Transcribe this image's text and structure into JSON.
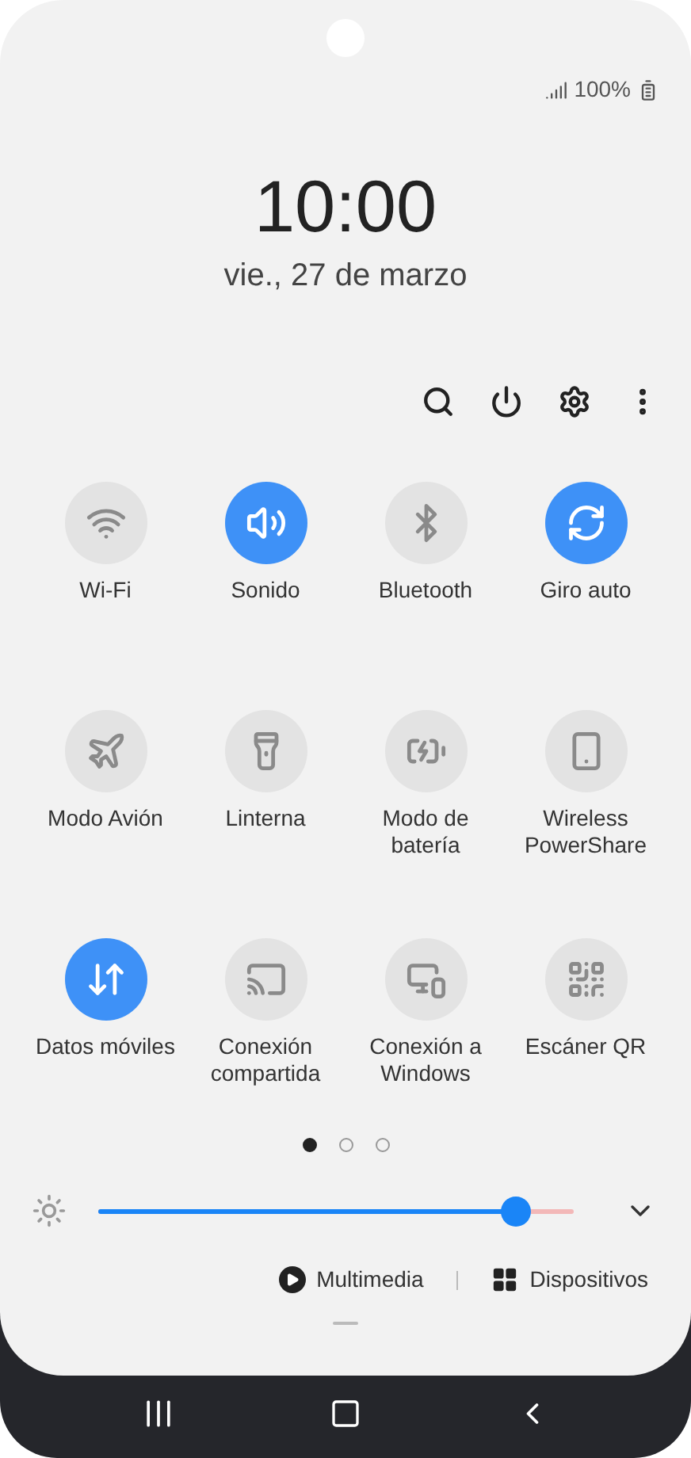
{
  "status_bar": {
    "battery": "100%"
  },
  "clock": {
    "time": "10:00",
    "date": "vie., 27 de marzo"
  },
  "tiles": [
    {
      "label": "Wi-Fi",
      "on": false
    },
    {
      "label": "Sonido",
      "on": true
    },
    {
      "label": "Bluetooth",
      "on": false
    },
    {
      "label": "Giro auto",
      "on": true
    },
    {
      "label": "Modo Avión",
      "on": false
    },
    {
      "label": "Linterna",
      "on": false
    },
    {
      "label": "Modo de batería",
      "on": false
    },
    {
      "label": "Wireless PowerShare",
      "on": false
    },
    {
      "label": "Datos móviles",
      "on": true
    },
    {
      "label": "Conexión compartida",
      "on": false
    },
    {
      "label": "Conexión a Windows",
      "on": false
    },
    {
      "label": "Escáner QR",
      "on": false
    }
  ],
  "pages": [
    {
      "selected": true
    },
    {
      "selected": false
    },
    {
      "selected": false
    }
  ],
  "brightness": {
    "level": 0.88
  },
  "footer": {
    "buttons": [
      "Multimedia",
      "Dispositivos"
    ]
  }
}
